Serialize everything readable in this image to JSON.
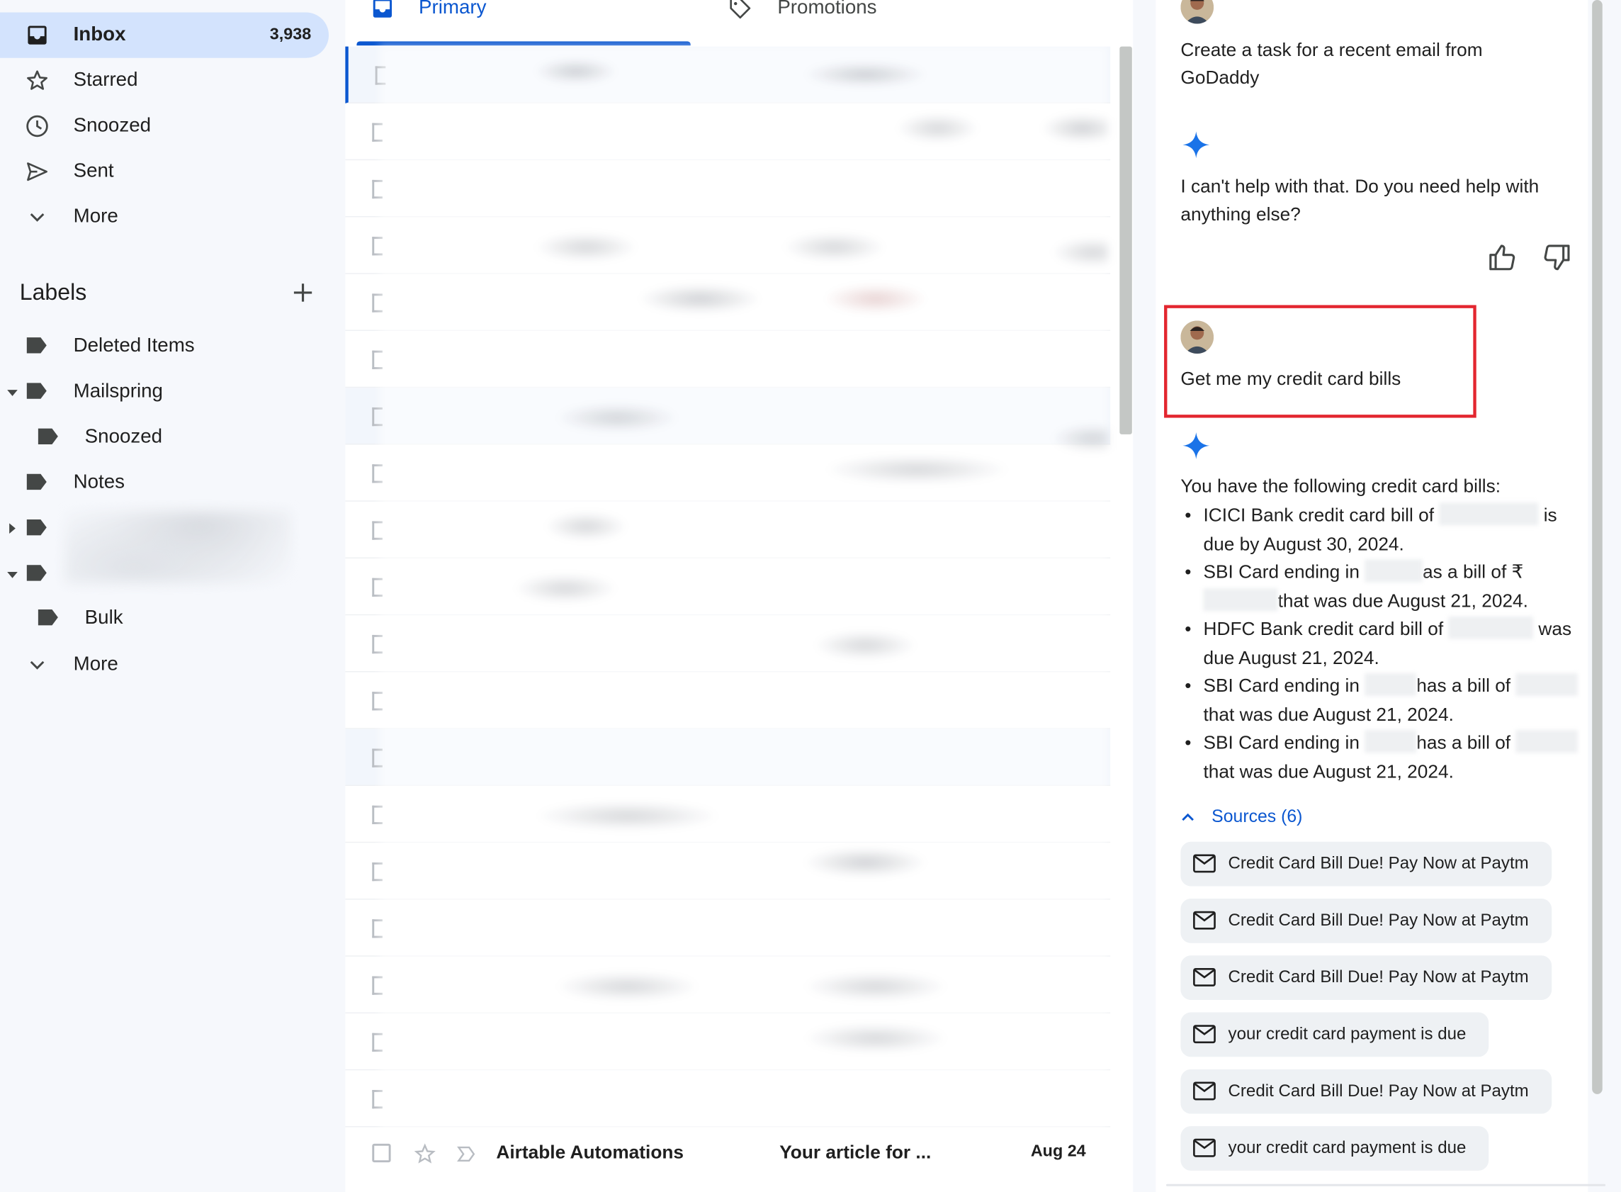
{
  "sidebar": {
    "nav": [
      {
        "label": "Inbox",
        "count": "3,938",
        "icon": "inbox-icon"
      },
      {
        "label": "Starred",
        "icon": "star-icon"
      },
      {
        "label": "Snoozed",
        "icon": "clock-icon"
      },
      {
        "label": "Sent",
        "icon": "send-icon"
      },
      {
        "label": "More",
        "icon": "chevron-down-icon"
      }
    ],
    "labels_title": "Labels",
    "labels": [
      {
        "label": "Deleted Items"
      },
      {
        "label": "Mailspring"
      },
      {
        "label": "Snoozed"
      },
      {
        "label": "Notes"
      },
      {
        "label": "Bulk"
      }
    ],
    "more_label": "More"
  },
  "tabs": [
    {
      "label": "Primary",
      "icon": "inbox-icon",
      "active": true
    },
    {
      "label": "Promotions",
      "icon": "tag-icon",
      "active": false
    }
  ],
  "maillist": {
    "last_row": {
      "sender": "Airtable Automations",
      "subject": "Your article for ...",
      "date": "Aug 24"
    }
  },
  "panel": {
    "prompt1": "Create a task for a recent email from GoDaddy",
    "reply1": "I can't help with that. Do you need help with anything else?",
    "prompt2": "Get me my credit card bills",
    "reply2_intro": "You have the following credit card bills:",
    "bills": [
      {
        "a": "ICICI Bank credit card bill of ",
        "b": " is due by August 30, 2024."
      },
      {
        "a": "SBI Card ending in ",
        "b": "as a bill of",
        "c": "₹",
        "d": "that was due August 21, 2024."
      },
      {
        "a": "HDFC Bank credit card bill of ",
        "b": " was due August 21, 2024."
      },
      {
        "a": "SBI Card ending in ",
        "b": "has a bill of",
        "c": "that was due August 21, 2024."
      },
      {
        "a": "SBI Card ending in ",
        "b": "has a bill of",
        "c": "that was due August 21, 2024."
      }
    ],
    "sources_label": "Sources (6)",
    "sources": [
      "Credit Card Bill Due! Pay Now at Paytm",
      "Credit Card Bill Due! Pay Now at Paytm",
      "Credit Card Bill Due! Pay Now at Paytm",
      "your credit card payment is due",
      "Credit Card Bill Due! Pay Now at Paytm",
      "your credit card payment is due"
    ]
  },
  "colors": {
    "accent": "#0b57d0",
    "active_nav_bg": "#d3e3fd",
    "highlight_border": "#e3262f",
    "gemini_spark": "#1a73e8"
  }
}
